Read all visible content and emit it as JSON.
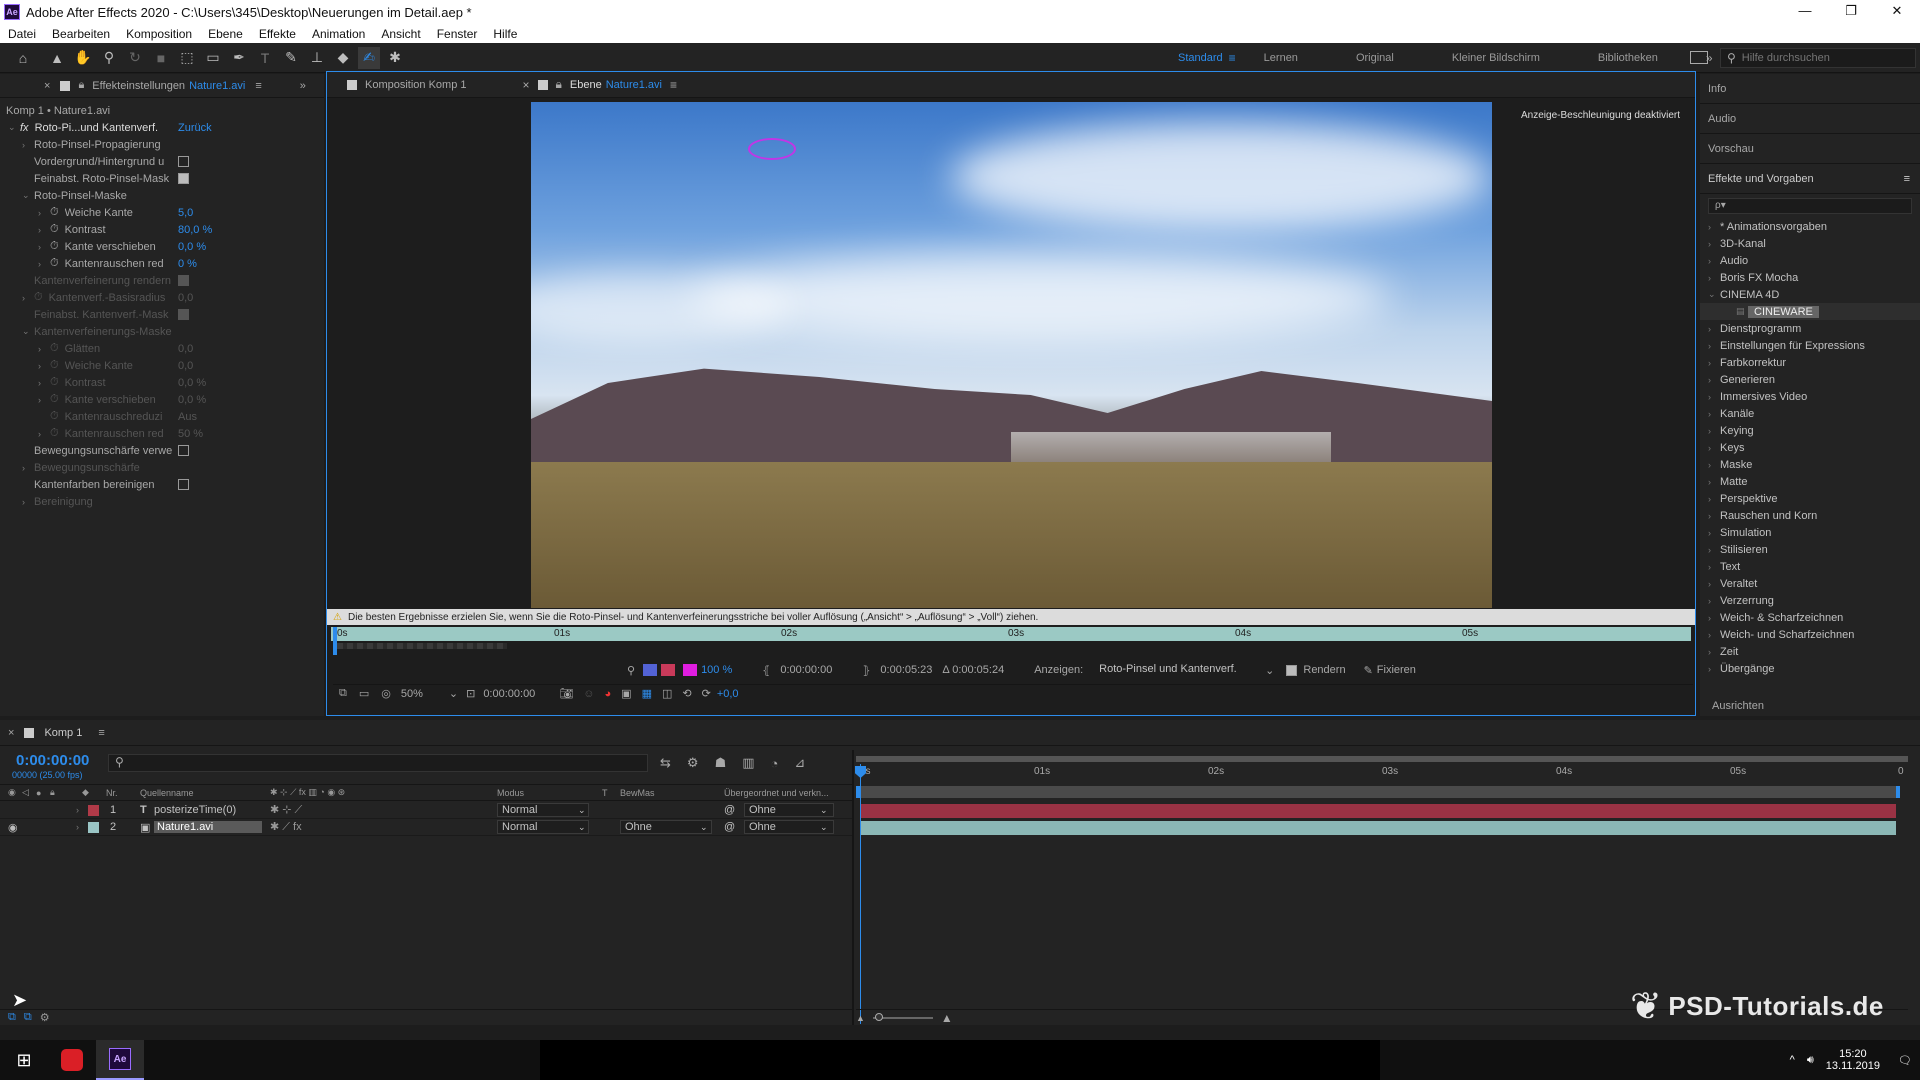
{
  "titlebar": {
    "title": "Adobe After Effects 2020 - C:\\Users\\345\\Desktop\\Neuerungen im Detail.aep *",
    "app_icon": "Ae",
    "controls": [
      "—",
      "❐",
      "✕"
    ]
  },
  "menu": [
    "Datei",
    "Bearbeiten",
    "Komposition",
    "Ebene",
    "Effekte",
    "Animation",
    "Ansicht",
    "Fenster",
    "Hilfe"
  ],
  "workspaces": [
    "Standard",
    "Lernen",
    "Original",
    "Kleiner Bildschirm",
    "Bibliotheken"
  ],
  "help_search": {
    "placeholder": "Hilfe durchsuchen"
  },
  "effects_panel": {
    "tab_label": "Effekteinstellungen",
    "tab_layer": "Nature1.avi",
    "comp_label": "Komp 1 • Nature1.avi",
    "effect_name": "Roto-Pi...und Kantenverf.",
    "reset": "Zurück",
    "props": [
      {
        "label": "Roto-Pinsel-Propagierung",
        "indent": 1,
        "twirl": "›",
        "dim": false
      },
      {
        "label": "Vordergrund/Hintergrund u",
        "indent": 1,
        "cb": "off",
        "dim": false
      },
      {
        "label": "Feinabst. Roto-Pinsel-Mask",
        "indent": 1,
        "cb": "on",
        "dim": false
      },
      {
        "label": "Roto-Pinsel-Maske",
        "indent": 1,
        "twirl": "⌄",
        "dim": false
      },
      {
        "label": "Weiche Kante",
        "indent": 2,
        "twirl": "›",
        "stop": true,
        "value": "5,0",
        "dim": false
      },
      {
        "label": "Kontrast",
        "indent": 2,
        "twirl": "›",
        "stop": true,
        "value": "80,0 %",
        "dim": false
      },
      {
        "label": "Kante verschieben",
        "indent": 2,
        "twirl": "›",
        "stop": true,
        "value": "0,0 %",
        "dim": false
      },
      {
        "label": "Kantenrauschen red",
        "indent": 2,
        "twirl": "›",
        "stop": true,
        "value": "0 %",
        "dim": false
      },
      {
        "label": "Kantenverfeinerung rendern",
        "indent": 1,
        "cb": "on",
        "dim": true
      },
      {
        "label": "Kantenverf.-Basisradius",
        "indent": 1,
        "twirl": "›",
        "stop": true,
        "value": "0,0",
        "dim": true
      },
      {
        "label": "Feinabst. Kantenverf.-Mask",
        "indent": 1,
        "cb": "on",
        "dim": true
      },
      {
        "label": "Kantenverfeinerungs-Maske",
        "indent": 1,
        "twirl": "⌄",
        "dim": true
      },
      {
        "label": "Glätten",
        "indent": 2,
        "twirl": "›",
        "stop": true,
        "value": "0,0",
        "dim": true
      },
      {
        "label": "Weiche Kante",
        "indent": 2,
        "twirl": "›",
        "stop": true,
        "value": "0,0",
        "dim": true
      },
      {
        "label": "Kontrast",
        "indent": 2,
        "twirl": "›",
        "stop": true,
        "value": "0,0 %",
        "dim": true
      },
      {
        "label": "Kante verschieben",
        "indent": 2,
        "twirl": "›",
        "stop": true,
        "value": "0,0 %",
        "dim": true
      },
      {
        "label": "Kantenrauschreduzi",
        "indent": 2,
        "stop": true,
        "value": "Aus",
        "dim": true
      },
      {
        "label": "Kantenrauschen red",
        "indent": 2,
        "twirl": "›",
        "stop": true,
        "value": "50 %",
        "dim": true
      },
      {
        "label": "Bewegungsunschärfe verwe",
        "indent": 1,
        "cb": "off",
        "dim": false
      },
      {
        "label": "Bewegungsunschärfe",
        "indent": 1,
        "twirl": "›",
        "dim": true
      },
      {
        "label": "Kantenfarben bereinigen",
        "indent": 1,
        "cb": "off",
        "dim": false
      },
      {
        "label": "Bereinigung",
        "indent": 1,
        "twirl": "›",
        "dim": true
      }
    ]
  },
  "viewer": {
    "tabs": [
      {
        "label": "Komposition Komp 1",
        "active": false
      },
      {
        "label": "Ebene",
        "layer": "Nature1.avi",
        "active": true
      }
    ],
    "accel_notice": "Anzeige-Beschleunigung deaktiviert",
    "warning": "Die besten Ergebnisse erzielen Sie, wenn Sie die Roto-Pinsel- und Kantenverfeinerungsstriche bei voller Auflösung („Ansicht“ > „Auflösung“ > „Voll“) ziehen.",
    "ruler": [
      "0s",
      "01s",
      "02s",
      "03s",
      "04s",
      "05s"
    ],
    "zoom_pct": "100 %",
    "time_in": "0:00:00:00",
    "time_out": "0:00:05:23",
    "duration": "Δ 0:00:05:24",
    "show_label": "Anzeigen:",
    "show_value": "Roto-Pinsel und Kantenverf.",
    "render": "Rendern",
    "freeze": "Fixieren",
    "mag": "50%",
    "time": "0:00:00:00",
    "exposure": "+0,0"
  },
  "right_panel": {
    "sections": [
      "Info",
      "Audio",
      "Vorschau"
    ],
    "effects_title": "Effekte und Vorgaben",
    "search_placeholder": "ρ▾",
    "items": [
      "* Animationsvorgaben",
      "3D-Kanal",
      "Audio",
      "Boris FX Mocha",
      "CINEMA 4D",
      "CINEWARE",
      "Dienstprogramm",
      "Einstellungen für Expressions",
      "Farbkorrektur",
      "Generieren",
      "Immersives Video",
      "Kanäle",
      "Keying",
      "Keys",
      "Maske",
      "Matte",
      "Perspektive",
      "Rauschen und Korn",
      "Simulation",
      "Stilisieren",
      "Text",
      "Veraltet",
      "Verzerrung",
      "Weich- & Scharfzeichnen",
      "Weich- und Scharfzeichnen",
      "Zeit",
      "Übergänge"
    ],
    "align": "Ausrichten"
  },
  "timeline": {
    "tab": "Komp 1",
    "timecode": "0:00:00:00",
    "fps": "00000 (25.00 fps)",
    "cols": {
      "nr": "Nr.",
      "source": "Quellenname",
      "mode": "Modus",
      "t": "T",
      "trkmat": "BewMas",
      "parent": "Übergeordnet und verkn..."
    },
    "ruler": [
      "0s",
      "01s",
      "02s",
      "03s",
      "04s",
      "05s",
      "0"
    ],
    "layers": [
      {
        "nr": "1",
        "type": "T",
        "name": "posterizeTime(0)",
        "mode": "Normal",
        "trkmat": "",
        "parent": "Ohne",
        "color": "#b03a48",
        "bar": "#9a3244"
      },
      {
        "nr": "2",
        "type": "▣",
        "name": "Nature1.avi",
        "mode": "Normal",
        "trkmat": "Ohne",
        "parent": "Ohne",
        "color": "#9ac5c5",
        "bar": "#8bb7b5"
      }
    ]
  },
  "taskbar": {
    "time": "15:20",
    "date": "13.11.2019"
  },
  "watermark": "PSD-Tutorials.de"
}
